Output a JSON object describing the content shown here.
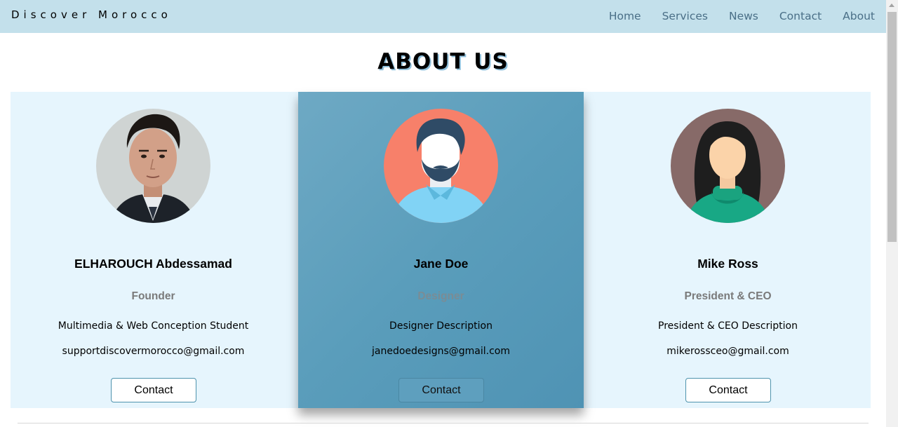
{
  "navbar": {
    "brand": "Discover Morocco",
    "links": [
      "Home",
      "Services",
      "News",
      "Contact",
      "About"
    ]
  },
  "page_title": "ABOUT US",
  "team": [
    {
      "name": "ELHAROUCH Abdessamad",
      "role": "Founder",
      "description": "Multimedia & Web Conception Student",
      "email": "supportdiscovermorocco@gmail.com",
      "button": "Contact",
      "avatar_icon": "photo-avatar-icon"
    },
    {
      "name": "Jane Doe",
      "role": "Designer",
      "description": "Designer Description",
      "email": "janedoedesigns@gmail.com",
      "button": "Contact",
      "avatar_icon": "man-avatar-icon"
    },
    {
      "name": "Mike Ross",
      "role": "President & CEO",
      "description": "President & CEO Description",
      "email": "mikerossceo@gmail.com",
      "button": "Contact",
      "avatar_icon": "woman-avatar-icon"
    }
  ],
  "colors": {
    "navbar_bg": "#c3e0eb",
    "card_bg": "#e6f5fd",
    "highlight_card": "#5a9dbb",
    "nav_link": "#4a6f87"
  }
}
